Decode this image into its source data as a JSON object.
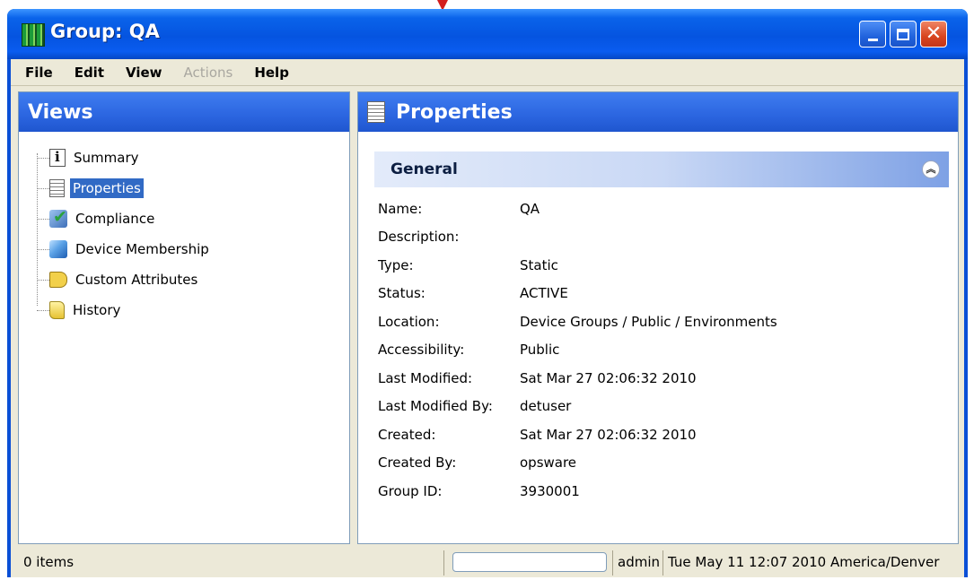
{
  "window": {
    "title": "Group: QA"
  },
  "menu": {
    "items": [
      {
        "label": "File",
        "enabled": true
      },
      {
        "label": "Edit",
        "enabled": true
      },
      {
        "label": "View",
        "enabled": true
      },
      {
        "label": "Actions",
        "enabled": false
      },
      {
        "label": "Help",
        "enabled": true
      }
    ]
  },
  "views": {
    "title": "Views",
    "items": [
      {
        "label": "Summary",
        "icon": "info-icon"
      },
      {
        "label": "Properties",
        "icon": "document-icon",
        "selected": true
      },
      {
        "label": "Compliance",
        "icon": "compliance-check-icon"
      },
      {
        "label": "Device Membership",
        "icon": "cube-icon"
      },
      {
        "label": "Custom Attributes",
        "icon": "tag-icon"
      },
      {
        "label": "History",
        "icon": "history-scroll-icon"
      }
    ]
  },
  "properties": {
    "title": "Properties",
    "section_title": "General",
    "rows": [
      {
        "label": "Name:",
        "value": "QA"
      },
      {
        "label": "Description:",
        "value": ""
      },
      {
        "label": "Type:",
        "value": "Static"
      },
      {
        "label": "Status:",
        "value": "ACTIVE"
      },
      {
        "label": "Location:",
        "value": "Device Groups / Public / Environments"
      },
      {
        "label": "Accessibility:",
        "value": "Public"
      },
      {
        "label": "Last Modified:",
        "value": "Sat Mar 27 02:06:32 2010"
      },
      {
        "label": "Last Modified By:",
        "value": "detuser"
      },
      {
        "label": "Created:",
        "value": "Sat Mar 27 02:06:32 2010"
      },
      {
        "label": "Created By:",
        "value": "opsware"
      },
      {
        "label": "Group ID:",
        "value": "3930001"
      }
    ]
  },
  "status": {
    "items_count": "0 items",
    "user": "admin",
    "timestamp": "Tue May 11 12:07 2010 America/Denver"
  },
  "colors": {
    "titlebar": "#0554e0",
    "panel_header": "#2b65e0",
    "selection": "#316ac5",
    "annotation_arrow": "#d21e1e"
  }
}
